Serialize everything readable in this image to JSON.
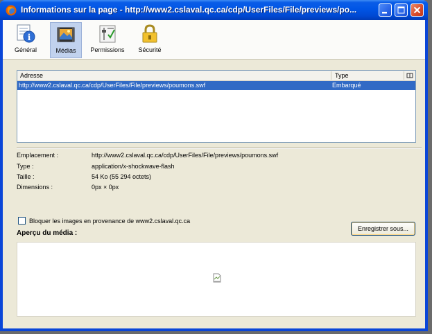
{
  "window": {
    "title": "Informations sur la page - http://www2.cslaval.qc.ca/cdp/UserFiles/File/previews/po..."
  },
  "toolbar": {
    "tabs": [
      {
        "label": "Général",
        "icon": "info-icon"
      },
      {
        "label": "Médias",
        "icon": "media-icon"
      },
      {
        "label": "Permissions",
        "icon": "permissions-icon"
      },
      {
        "label": "Sécurité",
        "icon": "security-lock-icon"
      }
    ],
    "selected": "Médias"
  },
  "media_list": {
    "columns": [
      "Adresse",
      "Type"
    ],
    "rows": [
      {
        "address": "http://www2.cslaval.qc.ca/cdp/UserFiles/File/previews/poumons.swf",
        "type": "Embarqué"
      }
    ]
  },
  "properties": {
    "location_label": "Emplacement :",
    "location_value": "http://www2.cslaval.qc.ca/cdp/UserFiles/File/previews/poumons.swf",
    "type_label": "Type :",
    "type_value": "application/x-shockwave-flash",
    "size_label": "Taille :",
    "size_value": "54 Ko (55 294 octets)",
    "dimensions_label": "Dimensions :",
    "dimensions_value": "0px × 0px"
  },
  "block_images_label": "Bloquer les images en provenance de www2.cslaval.qc.ca",
  "save_button_label": "Enregistrer sous...",
  "preview_label": "Aperçu du média :",
  "colors": {
    "titlebar": "#0055e5",
    "selection": "#316ac5",
    "face": "#ece9d8"
  }
}
